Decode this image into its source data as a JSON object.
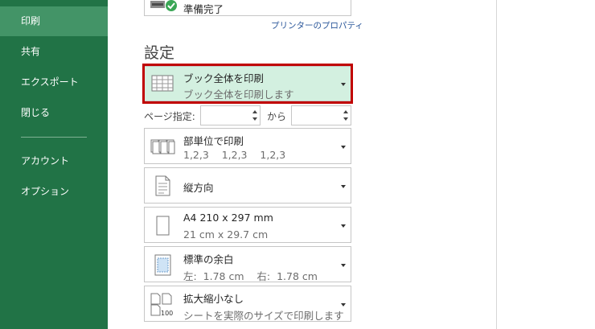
{
  "sidebar": {
    "items": [
      {
        "label": "印刷",
        "active": true
      },
      {
        "label": "共有"
      },
      {
        "label": "エクスポート"
      },
      {
        "label": "閉じる"
      },
      {
        "label": "アカウント"
      },
      {
        "label": "オプション"
      }
    ]
  },
  "printer": {
    "status": "準備完了",
    "properties_link": "プリンターのプロパティ"
  },
  "settings": {
    "title": "設定",
    "scope": {
      "main": "ブック全体を印刷",
      "sub": "ブック全体を印刷します"
    },
    "pages": {
      "label": "ページ指定:",
      "from_value": "",
      "to_label": "から",
      "to_value": ""
    },
    "collate": {
      "main": "部単位で印刷",
      "sub": "1,2,3    1,2,3    1,2,3"
    },
    "orientation": {
      "main": "縦方向"
    },
    "paper": {
      "main": "A4 210 x 297 mm",
      "sub": "21 cm x 29.7 cm"
    },
    "margins": {
      "main": "標準の余白",
      "sub": "左:  1.78 cm    右:  1.78 cm"
    },
    "scaling": {
      "main": "拡大縮小なし",
      "sub": "シートを実際のサイズで印刷します",
      "icon_text": "100"
    }
  },
  "colors": {
    "sidebar": "#217346",
    "active": "#439467",
    "highlight": "#c00000",
    "selected_bg": "#d3f0e0",
    "link": "#2b579a"
  }
}
